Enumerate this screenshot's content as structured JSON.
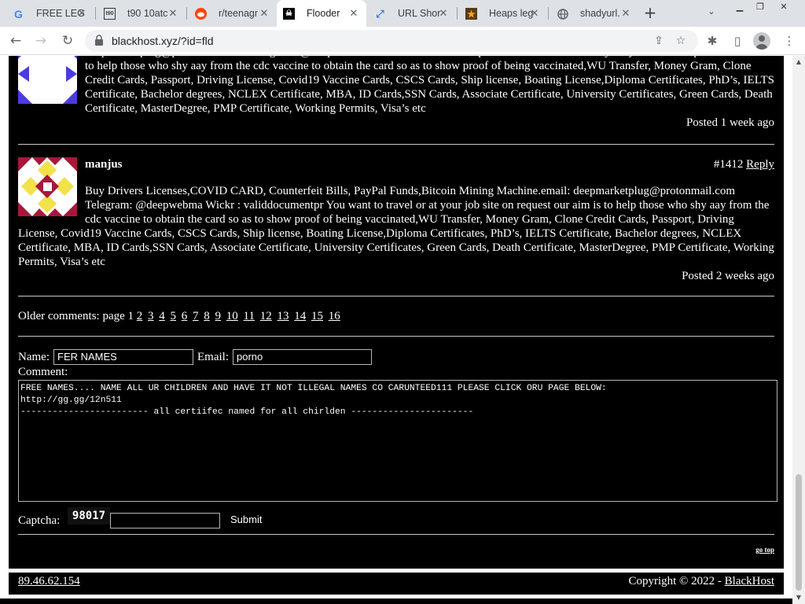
{
  "browser": {
    "tabs": [
      {
        "label": "FREE LEG",
        "favicon": "google-icon"
      },
      {
        "label": "t90 10atc",
        "favicon": "site-icon"
      },
      {
        "label": "r/teenagr",
        "favicon": "reddit-icon"
      },
      {
        "label": "Flooder",
        "favicon": "pirate-flag-icon"
      },
      {
        "label": "URL Shor",
        "favicon": "link-icon"
      },
      {
        "label": "Heaps leg",
        "favicon": "star-icon"
      },
      {
        "label": "shadyurl.",
        "favicon": "globe-icon"
      }
    ],
    "address": "blackhost.xyz/?id=fld"
  },
  "comments": [
    {
      "text": "deepmarketplug@protonmail.com Telegram: @deepwebma Wickr : validdocumentpr You want to travel or at your job site on request our aim is to help those who shy aay from the cdc vaccine to obtain the card so as to show proof of being vaccinated,WU Transfer, Money Gram, Clone Credit Cards, Passport, Driving License, Covid19 Vaccine Cards, CSCS Cards, Ship license, Boating License,Diploma Certificates, PhD’s, IELTS Certificate, Bachelor degrees, NCLEX Certificate, MBA, ID Cards,SSN Cards, Associate Certificate, University Certificates, Green Cards, Death Certificate, MasterDegree, PMP Certificate, Working Permits, Visa’s etc",
      "posted": "Posted 1 week ago"
    },
    {
      "author": "manjus",
      "number": "#1412",
      "reply": "Reply",
      "text": "Buy Drivers Licenses,COVID CARD, Counterfeit Bills, PayPal Funds,Bitcoin Mining Machine.email: deepmarketplug@protonmail.com Telegram: @deepwebma Wickr : validdocumentpr You want to travel or at your job site on request our aim is to help those who shy aay from the cdc vaccine to obtain the card so as to show proof of being vaccinated,WU Transfer, Money Gram, Clone Credit Cards, Passport, Driving License, Covid19 Vaccine Cards, CSCS Cards, Ship license, Boating License,Diploma Certificates, PhD’s, IELTS Certificate, Bachelor degrees, NCLEX Certificate, MBA, ID Cards,SSN Cards, Associate Certificate, University Certificates, Green Cards, Death Certificate, MasterDegree, PMP Certificate, Working Permits, Visa’s etc",
      "posted": "Posted 2 weeks ago"
    }
  ],
  "older": {
    "label": "Older comments: page",
    "current": "1",
    "pages": [
      "2",
      "3",
      "4",
      "5",
      "6",
      "7",
      "8",
      "9",
      "10",
      "11",
      "12",
      "13",
      "14",
      "15",
      "16"
    ]
  },
  "form": {
    "name_label": "Name:",
    "name_value": "FER NAMES",
    "email_label": "Email:",
    "email_value": "porno",
    "comment_label": "Comment:",
    "comment_value": "FREE NAMES.... NAME ALL UR CHILDREN AND HAVE IT NOT ILLEGAL NAMES CO CARUNTEED111 PLEASE CLICK ORU PAGE BELOW:\nhttp://gg.gg/12n511\n------------------------ all certiifec named for all chirlden -----------------------",
    "captcha_label": "Captcha:",
    "captcha_text": "98017",
    "captcha_value": "",
    "submit_label": "Submit"
  },
  "gotop": "go top",
  "footer": {
    "ip": "89.46.62.154",
    "copyright": "Copyright © 2022 -",
    "brand": "BlackHost"
  },
  "colors": {
    "page_bg": "#000000",
    "text": "#ffffff",
    "frame": "#ffffff"
  }
}
